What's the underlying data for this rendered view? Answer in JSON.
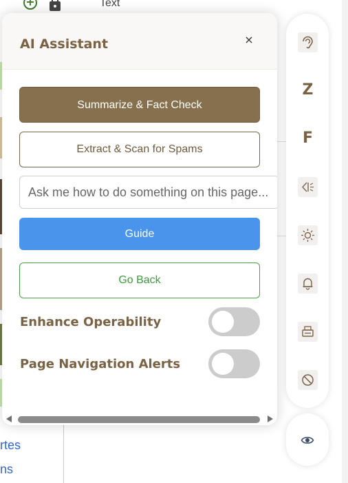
{
  "background": {
    "top_label": "Text",
    "link_fragments": [
      "rtes",
      "ns"
    ],
    "icons": [
      "add-circle-icon",
      "lock-icon"
    ]
  },
  "panel": {
    "title": "AI Assistant",
    "close_label": "×",
    "summarize_label": "Summarize & Fact Check",
    "extract_label": "Extract & Scan for Spams",
    "ask_placeholder": "Ask me how to do something on this page...",
    "ask_value": "",
    "guide_label": "Guide",
    "go_back_label": "Go Back",
    "toggles": [
      {
        "label": "Enhance Operability",
        "on": false
      },
      {
        "label": "Page Navigation Alerts",
        "on": false
      }
    ]
  },
  "toolbar": {
    "items": [
      {
        "name": "ear-icon"
      },
      {
        "name": "zoom-letter",
        "text": "Z"
      },
      {
        "name": "font-letter",
        "text": "F"
      },
      {
        "name": "speaker-icon"
      },
      {
        "name": "brightness-icon"
      },
      {
        "name": "bell-icon"
      },
      {
        "name": "print-icon"
      },
      {
        "name": "block-icon"
      }
    ],
    "eye_icon": "eye-icon"
  },
  "colors": {
    "brand_brown": "#86704d",
    "title_brown": "#7a6244",
    "guide_blue": "#4a94ec",
    "back_green": "#3f9a3f",
    "toggle_off": "#cccccc"
  }
}
